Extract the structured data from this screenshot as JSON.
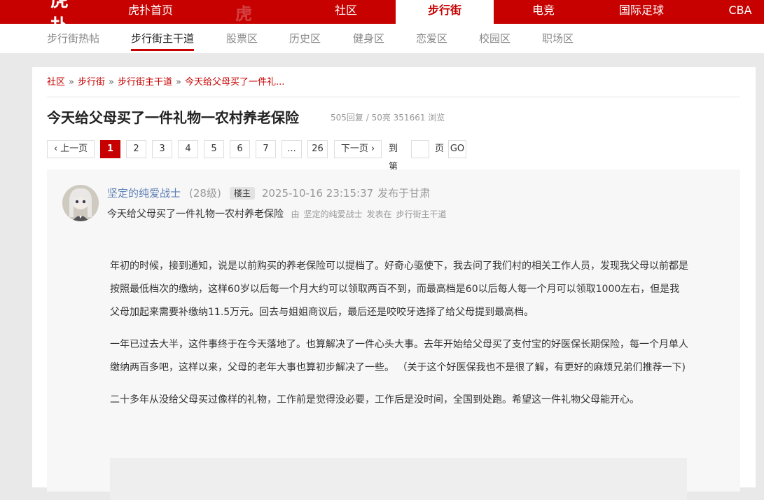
{
  "topnav": {
    "logo": "虎扑",
    "items": [
      {
        "label": "虎扑首页"
      },
      {
        "label": "社区"
      },
      {
        "label": "步行街"
      },
      {
        "label": "电竞"
      },
      {
        "label": "国际足球"
      },
      {
        "label": "CBA"
      }
    ],
    "active": "步行街"
  },
  "subnav": {
    "items": [
      {
        "label": "步行街热帖"
      },
      {
        "label": "步行街主干道"
      },
      {
        "label": "股票区"
      },
      {
        "label": "历史区"
      },
      {
        "label": "健身区"
      },
      {
        "label": "恋爱区"
      },
      {
        "label": "校园区"
      },
      {
        "label": "职场区"
      }
    ],
    "active": "步行街主干道"
  },
  "breadcrumb": {
    "items": [
      "社区",
      "步行街",
      "步行街主干道",
      "今天给父母买了一件礼..."
    ],
    "separator": "»"
  },
  "thread": {
    "title": "今天给父母买了一件礼物一农村养老保险",
    "stats": "505回复 / 50亮 351661 浏览"
  },
  "pager": {
    "prev": "‹ 上一页",
    "pages": [
      "1",
      "2",
      "3",
      "4",
      "5",
      "6",
      "7",
      "...",
      "26"
    ],
    "current": "1",
    "next": "下一页 ›",
    "goto_prefix": "到第",
    "goto_suffix": "页",
    "go": "GO"
  },
  "post": {
    "author": "坚定的纯爱战士",
    "level": "(28级)",
    "badge": "楼主",
    "time": "2025-10-16 23:15:37",
    "location": "发布于甘肃",
    "subtitle": "今天给父母买了一件礼物一农村养老保险",
    "meta_by": "由",
    "meta_author": "坚定的纯爱战士",
    "meta_posted": "发表在",
    "meta_board": "步行街主干道",
    "paragraphs": [
      "年初的时候，接到通知，说是以前购买的养老保险可以提档了。好奇心驱使下，我去问了我们村的相关工作人员，发现我父母以前都是按照最低档次的缴纳，这样60岁以后每一个月大约可以领取两百不到，而最高档是60以后每人每一个月可以领取1000左右，但是我父母加起来需要补缴纳11.5万元。回去与姐姐商议后，最后还是咬咬牙选择了给父母提到最高档。",
      "一年已过去大半，这件事终于在今天落地了。也算解决了一件心头大事。去年开始给父母买了支付宝的好医保长期保险，每一个月单人缴纳两百多吧，这样以来，父母的老年大事也算初步解决了一些。 （关于这个好医保我也不是很了解，有更好的麻烦兄弟们推荐一下)",
      "二十多年从没给父母买过像样的礼物，工作前是觉得没必要，工作后是没时间，全国到处跑。希望这一件礼物父母能开心。"
    ]
  },
  "colors": {
    "brand_red": "#c60100",
    "author_blue": "#5d7fb5"
  }
}
